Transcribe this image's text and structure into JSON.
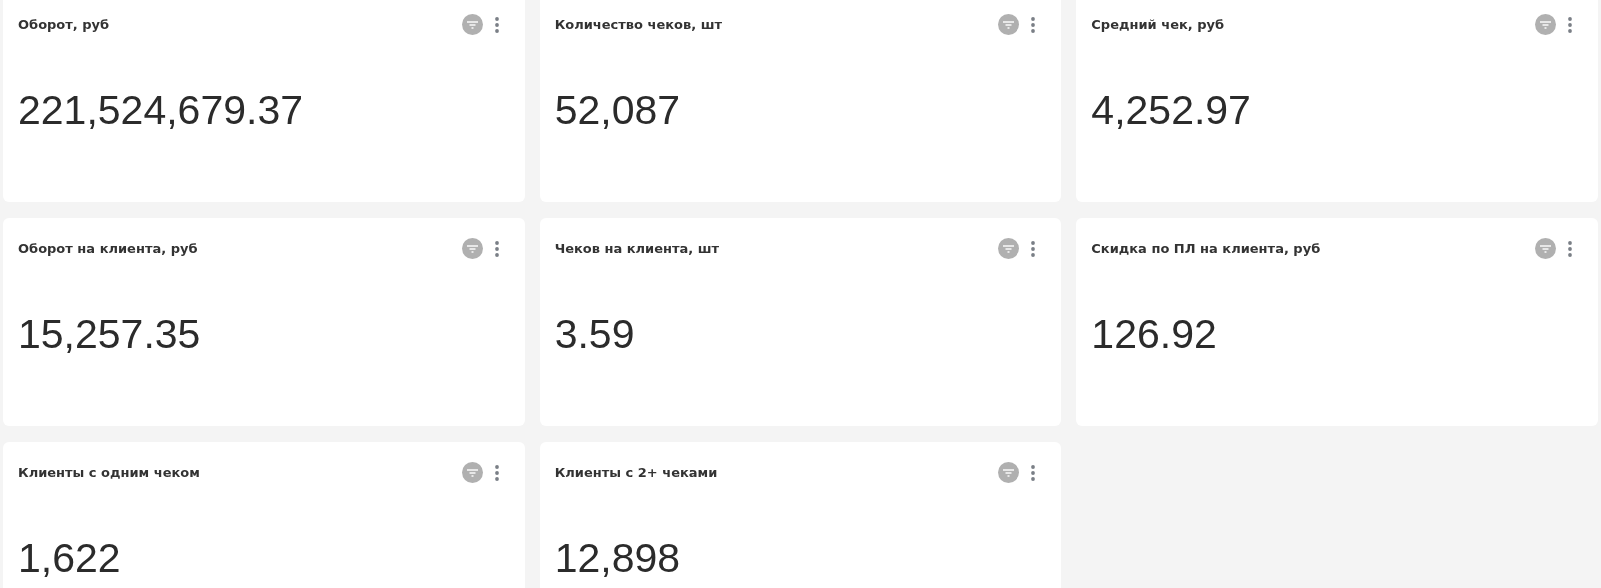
{
  "cards": [
    {
      "title": "Оборот, руб",
      "value": "221,524,679.37"
    },
    {
      "title": "Количество чеков, шт",
      "value": "52,087"
    },
    {
      "title": "Средний чек, руб",
      "value": "4,252.97"
    },
    {
      "title": "Оборот на клиента, руб",
      "value": "15,257.35"
    },
    {
      "title": "Чеков на клиента, шт",
      "value": "3.59"
    },
    {
      "title": "Скидка по ПЛ на клиента, руб",
      "value": "126.92"
    },
    {
      "title": "Клиенты с одним чеком",
      "value": "1,622"
    },
    {
      "title": "Клиенты с 2+ чеками",
      "value": "12,898"
    }
  ]
}
